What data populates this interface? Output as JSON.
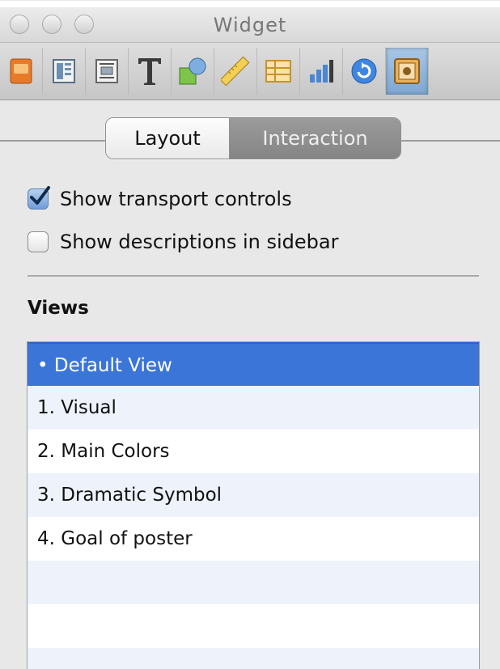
{
  "window": {
    "title": "Widget"
  },
  "toolbar": {
    "items": [
      {
        "name": "document-inspector-icon"
      },
      {
        "name": "layout-inspector-icon"
      },
      {
        "name": "wrap-inspector-icon"
      },
      {
        "name": "text-inspector-icon"
      },
      {
        "name": "graphic-inspector-icon"
      },
      {
        "name": "metrics-inspector-icon"
      },
      {
        "name": "table-inspector-icon"
      },
      {
        "name": "chart-inspector-icon"
      },
      {
        "name": "link-inspector-icon"
      },
      {
        "name": "widget-inspector-icon",
        "active": true
      }
    ]
  },
  "tabs": {
    "layout_label": "Layout",
    "interaction_label": "Interaction",
    "selected": "Interaction"
  },
  "options": {
    "transport_label": "Show transport controls",
    "transport_checked": true,
    "descriptions_label": "Show descriptions in sidebar",
    "descriptions_checked": false
  },
  "views": {
    "title": "Views",
    "items": [
      "• Default View",
      "1. Visual",
      "2. Main Colors",
      "3. Dramatic Symbol",
      "4. Goal of poster"
    ],
    "selected_index": 0
  },
  "colors": {
    "selection": "#3a75d7",
    "alternate_row": "#eef3fb",
    "panel_bg": "#e8e8e8"
  }
}
